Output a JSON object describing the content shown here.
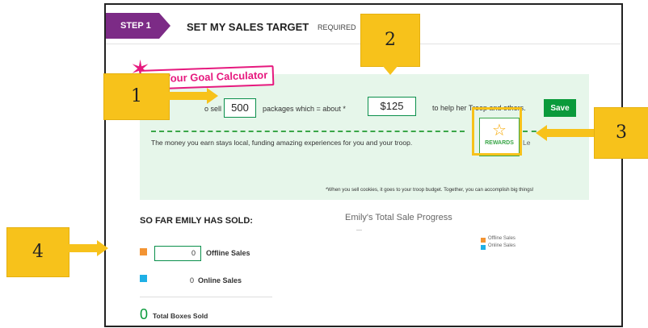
{
  "step": {
    "badge": "STEP 1",
    "title": "SET MY SALES TARGET",
    "required": "REQUIRED"
  },
  "calculator": {
    "banner": "Your Goal Calculator",
    "sell_prefix": "o sell",
    "packages_value": "500",
    "packages_text": "packages which = about *",
    "amount_value": "$125",
    "help_text": "to help her Troop and others.",
    "save_label": "Save",
    "money_text": "The money you earn stays local, funding amazing experiences for you and your troop.",
    "rewards_label": "REWARDS",
    "side_text": "Le"
  },
  "footnote": "*When you sell cookies, it goes to your troop budget. Together, you can accomplish big things!",
  "sold": {
    "title": "SO FAR EMILY HAS SOLD:",
    "offline_value": "0",
    "offline_label": "Offline Sales",
    "online_value": "0",
    "online_label": "Online Sales",
    "total_value": "0",
    "total_label": "Total Boxes Sold"
  },
  "chart": {
    "title": "Emily's Total Sale Progress",
    "small_text": "—",
    "legend_offline": "Offline Sales",
    "legend_online": "Online Sales"
  },
  "colors": {
    "offline": "#f39433",
    "online": "#1fb0e6",
    "brand_purple": "#7c2b86",
    "accent_green": "#0a9a3b",
    "callout": "#f7c21b"
  },
  "callouts": {
    "c1": "1",
    "c2": "2",
    "c3": "3",
    "c4": "4"
  }
}
